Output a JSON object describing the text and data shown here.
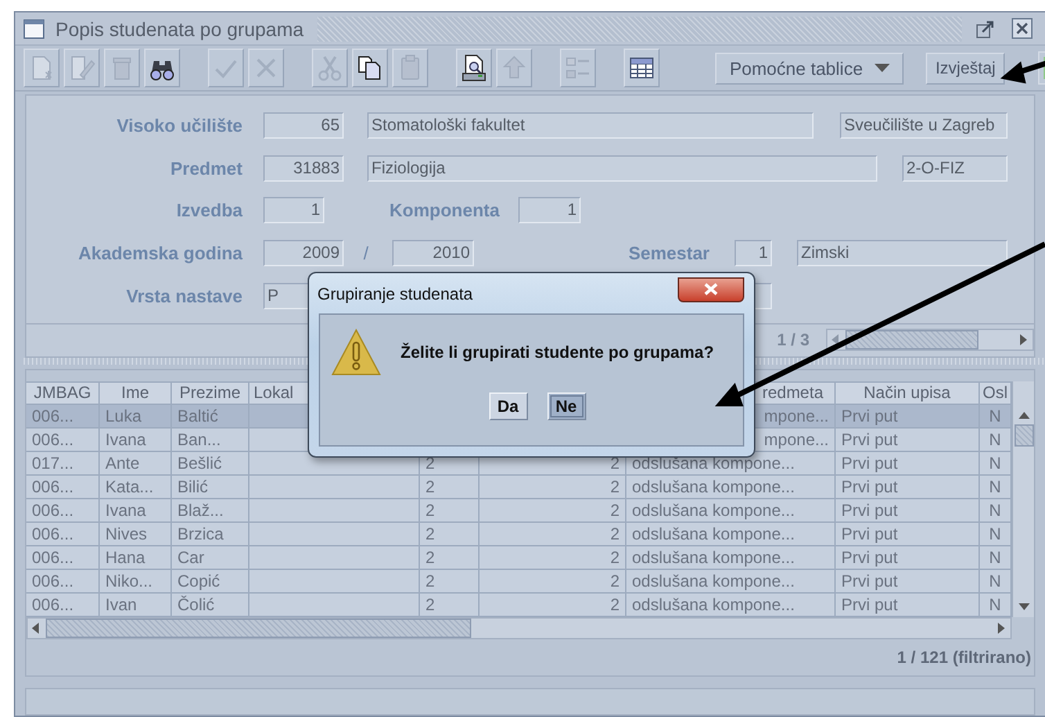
{
  "window": {
    "title": "Popis studenata po grupama"
  },
  "toolbar": {
    "groups": [
      [
        {
          "kind": "new",
          "disabled": true
        },
        {
          "kind": "edit",
          "disabled": true
        },
        {
          "kind": "trash",
          "disabled": true
        },
        {
          "kind": "binoculars",
          "disabled": false
        }
      ],
      [
        {
          "kind": "check",
          "disabled": true
        },
        {
          "kind": "cross",
          "disabled": true
        }
      ],
      [
        {
          "kind": "scissors",
          "disabled": true
        },
        {
          "kind": "copy",
          "disabled": false
        },
        {
          "kind": "paste",
          "disabled": true
        }
      ],
      [
        {
          "kind": "preview",
          "disabled": false
        },
        {
          "kind": "upload",
          "disabled": true
        }
      ],
      [
        {
          "kind": "checklist",
          "disabled": true
        }
      ],
      [
        {
          "kind": "grid",
          "disabled": false
        }
      ]
    ],
    "menu_button": {
      "label": "Pomoćne tablice"
    },
    "report_button": {
      "label": "Izvještaj"
    }
  },
  "form": {
    "rows": [
      {
        "label": "Visoko učilište",
        "items": [
          {
            "kind": "number",
            "value": "65"
          },
          {
            "kind": "text",
            "value": "Stomatološki fakultet"
          },
          {
            "kind": "text",
            "value": "Sveučilište u Zagreb"
          }
        ]
      },
      {
        "label": "Predmet",
        "items": [
          {
            "kind": "number",
            "value": "31883"
          },
          {
            "kind": "text",
            "value": "Fiziologija"
          },
          {
            "kind": "text",
            "value": "2-O-FIZ"
          }
        ]
      },
      {
        "label": "Izvedba",
        "items": [
          {
            "kind": "number",
            "value": "1"
          },
          {
            "kind": "label",
            "value": "Komponenta"
          },
          {
            "kind": "number",
            "value": "1"
          }
        ]
      },
      {
        "label": "Akademska godina",
        "items": [
          {
            "kind": "number",
            "value": "2009"
          },
          {
            "kind": "separator",
            "value": "/"
          },
          {
            "kind": "number",
            "value": "2010"
          },
          {
            "kind": "label",
            "value": "Semestar"
          },
          {
            "kind": "number",
            "value": "1"
          },
          {
            "kind": "text",
            "value": "Zimski"
          }
        ]
      },
      {
        "label": "Vrsta nastave",
        "items": [
          {
            "kind": "text",
            "value": "P"
          },
          {
            "kind": "text"
          }
        ]
      }
    ],
    "pager": "1 / 3"
  },
  "table": {
    "columns": [
      {
        "label": "JMBAG"
      },
      {
        "label": "Ime"
      },
      {
        "label": "Prezime"
      },
      {
        "label": "Lokal"
      },
      {},
      {},
      {
        "label": "redmeta"
      },
      {
        "label": "Način upisa"
      },
      {
        "label": "Osl"
      }
    ],
    "rows": [
      {
        "selected": true,
        "cells": [
          "006...",
          "Luka",
          "Baltić",
          null,
          null,
          null,
          "mpone...",
          "Prvi put",
          "N"
        ]
      },
      {
        "selected": false,
        "cells": [
          "006...",
          "Ivana",
          "Ban...",
          null,
          null,
          null,
          "mpone...",
          "Prvi put",
          "N"
        ]
      },
      {
        "selected": false,
        "cells": [
          "017...",
          "Ante",
          "Bešlić",
          null,
          "2",
          "2",
          "odslušana kompone...",
          "Prvi put",
          "N"
        ]
      },
      {
        "selected": false,
        "cells": [
          "006...",
          "Kata...",
          "Bilić",
          null,
          "2",
          "2",
          "odslušana kompone...",
          "Prvi put",
          "N"
        ]
      },
      {
        "selected": false,
        "cells": [
          "006...",
          "Ivana",
          "Blaž...",
          null,
          "2",
          "2",
          "odslušana kompone...",
          "Prvi put",
          "N"
        ]
      },
      {
        "selected": false,
        "cells": [
          "006...",
          "Nives",
          "Brzica",
          null,
          "2",
          "2",
          "odslušana kompone...",
          "Prvi put",
          "N"
        ]
      },
      {
        "selected": false,
        "cells": [
          "006...",
          "Hana",
          "Car",
          null,
          "2",
          "2",
          "odslušana kompone...",
          "Prvi put",
          "N"
        ]
      },
      {
        "selected": false,
        "cells": [
          "006...",
          "Niko...",
          "Copić",
          null,
          "2",
          "2",
          "odslušana kompone...",
          "Prvi put",
          "N"
        ]
      },
      {
        "selected": false,
        "cells": [
          "006...",
          "Ivan",
          "Čolić",
          null,
          "2",
          "2",
          "odslušana kompone...",
          "Prvi put",
          "N"
        ]
      }
    ],
    "count": "1 / 121 (filtrirano)"
  },
  "dialog": {
    "title": "Grupiranje studenata",
    "message": "Želite li grupirati studente po grupama?",
    "buttons": [
      {
        "label": "Da",
        "selected": false
      },
      {
        "label": "Ne",
        "selected": true
      }
    ]
  }
}
